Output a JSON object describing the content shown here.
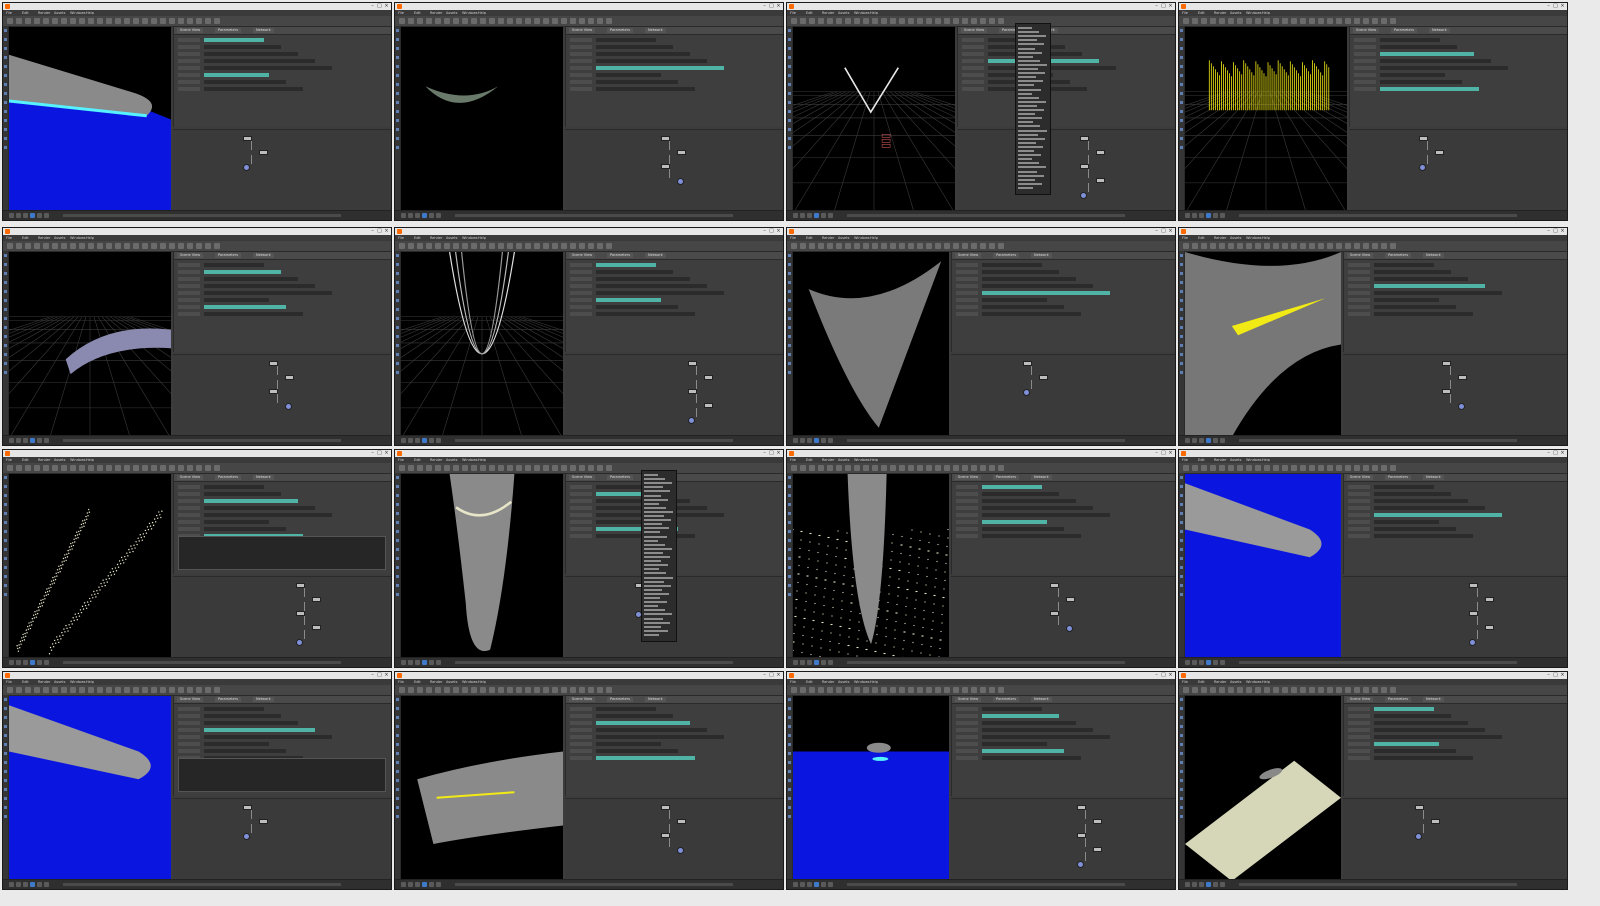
{
  "app": {
    "menu": [
      "File",
      "Edit",
      "Render",
      "Assets",
      "Windows",
      "Help"
    ],
    "pane_tabs": [
      "Scene View",
      "Parameters",
      "Network"
    ]
  },
  "tiles": [
    {
      "scene": "boat-water",
      "layout": "vp-left-narrow",
      "viewport_bg": "#000000"
    },
    {
      "scene": "hull-small",
      "layout": "vp-left-narrow",
      "viewport_bg": "#000000"
    },
    {
      "scene": "v-curve",
      "layout": "vp-left-narrow",
      "viewport_bg": "#000000",
      "menu_open": true
    },
    {
      "scene": "yellow-spikes",
      "layout": "vp-left-narrow",
      "viewport_bg": "#000000"
    },
    {
      "scene": "ribbon",
      "layout": "vp-left-narrow",
      "viewport_bg": "#000000"
    },
    {
      "scene": "curves-grid",
      "layout": "vp-left-narrow",
      "viewport_bg": "#000000"
    },
    {
      "scene": "hull-front",
      "layout": "vp-left-wide",
      "viewport_bg": "#000000"
    },
    {
      "scene": "hull-yellow-streak",
      "layout": "vp-left-wide",
      "viewport_bg": "#000000"
    },
    {
      "scene": "particles-trails",
      "layout": "vp-left-narrow",
      "viewport_bg": "#000000",
      "code": true
    },
    {
      "scene": "hull-bottom",
      "layout": "vp-left-narrow",
      "viewport_bg": "#000000",
      "menu_open": true
    },
    {
      "scene": "particles-splash",
      "layout": "vp-left-wide",
      "viewport_bg": "#000000"
    },
    {
      "scene": "boat-blue",
      "layout": "vp-left-wide",
      "viewport_bg": "#0a16e0"
    },
    {
      "scene": "boat-blue-2",
      "layout": "vp-left-narrow",
      "viewport_bg": "#0a16e0",
      "code": true
    },
    {
      "scene": "hull-yellow-line",
      "layout": "vp-left-narrow",
      "viewport_bg": "#000000"
    },
    {
      "scene": "boat-ocean",
      "layout": "vp-left-wide",
      "viewport_bg": "#000000"
    },
    {
      "scene": "plane-boat",
      "layout": "vp-left-wide",
      "viewport_bg": "#000000"
    }
  ],
  "colors": {
    "water_blue": "#0a16e0",
    "foam_cyan": "#57f2ff",
    "highlight_yellow": "#f2ea15",
    "hull_gray": "#8a8a8a",
    "particle_cream": "#e8e6c8",
    "node_teal": "#4fb3a6"
  }
}
